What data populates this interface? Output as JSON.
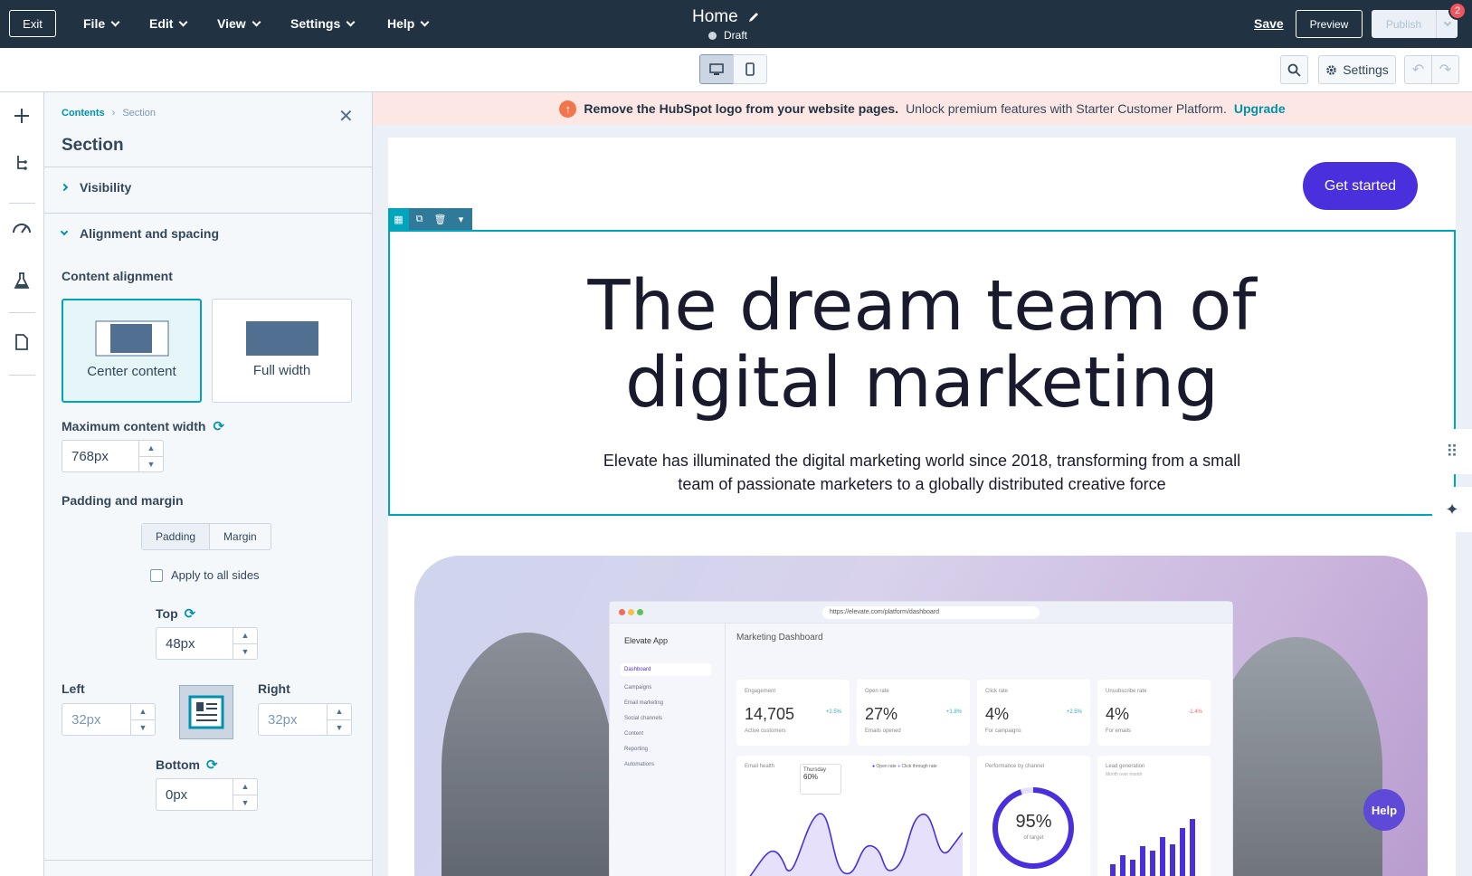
{
  "topbar": {
    "exit_label": "Exit",
    "menus": [
      "File",
      "Edit",
      "View",
      "Settings",
      "Help"
    ],
    "page_title": "Home",
    "status": "Draft",
    "save_label": "Save",
    "preview_label": "Preview",
    "publish_label": "Publish",
    "notification_count": "2"
  },
  "subbar": {
    "settings_label": "Settings",
    "devices": [
      "desktop-icon",
      "mobile-icon"
    ]
  },
  "rail": {
    "icons": [
      "plus-icon",
      "layers-tree-icon",
      "gauge-icon",
      "flask-icon",
      "document-icon"
    ]
  },
  "panel": {
    "breadcrumb_root": "Contents",
    "breadcrumb_current": "Section",
    "title": "Section",
    "accordion_visibility": "Visibility",
    "accordion_alignment": "Alignment and spacing",
    "content_alignment_label": "Content alignment",
    "option_center": "Center content",
    "option_full": "Full width",
    "max_width_label": "Maximum content width",
    "max_width_value": "768px",
    "padding_margin_label": "Padding and margin",
    "tab_padding": "Padding",
    "tab_margin": "Margin",
    "apply_all_label": "Apply to all sides",
    "top_label": "Top",
    "top_value": "48px",
    "left_label": "Left",
    "left_value": "32px",
    "right_label": "Right",
    "right_value": "32px",
    "bottom_label": "Bottom",
    "bottom_value": "0px"
  },
  "canvas": {
    "banner_bold": "Remove the HubSpot logo from your website pages.",
    "banner_text": "Unlock premium features with Starter Customer Platform.",
    "banner_link": "Upgrade",
    "cta_label": "Get started",
    "hero_title_line1": "The dream team of",
    "hero_title_line2": "digital marketing",
    "hero_sub_line1": "Elevate has illuminated the digital marketing world since 2018, transforming from a small",
    "hero_sub_line2": "team of passionate marketers to a globally distributed creative force",
    "help_label": "Help"
  },
  "dashboard": {
    "url": "https://elevate.com/platform/dashboard",
    "app_name": "Elevate App",
    "title": "Marketing Dashboard",
    "nav": [
      "Dashboard",
      "Campaigns",
      "Email marketing",
      "Social channels",
      "Content",
      "Reporting",
      "Automations"
    ],
    "kpis": [
      {
        "label": "Engagement",
        "value": "14,705",
        "sub": "Active customers",
        "change": "+2.5%"
      },
      {
        "label": "Open rate",
        "value": "27%",
        "sub": "Emails opened",
        "change": "+1.8%"
      },
      {
        "label": "Click rate",
        "value": "4%",
        "sub": "For campaigns",
        "change": "+2.5%"
      },
      {
        "label": "Unsubscribe rate",
        "value": "4%",
        "sub": "For emails",
        "change": "-1.4%"
      }
    ],
    "email_health_label": "Email health",
    "tooltip_day": "Thursday",
    "tooltip_value": "60%",
    "legend_open": "Open rate",
    "legend_click": "Click through rate",
    "performance_label": "Performance by channel",
    "gauge_value": "95%",
    "gauge_sub": "of target",
    "lead_gen_label": "Lead generation",
    "lead_gen_sub": "Month over month"
  },
  "colors": {
    "topbar_bg": "#213343",
    "accent_teal": "#00a4bd",
    "cta_purple": "#4a2fdc",
    "banner_bg": "#fde7e4"
  }
}
